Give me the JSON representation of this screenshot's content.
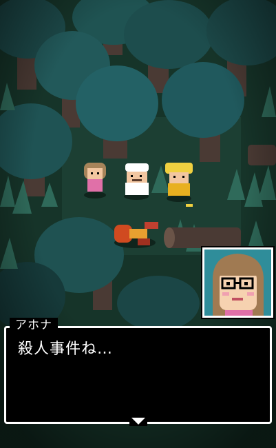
{
  "dialog": {
    "speaker": "アホナ",
    "text": "殺人事件ね…"
  },
  "scene": {
    "location_description": "",
    "characters": [
      "girl-npc",
      "chef-npc",
      "blond-npc",
      "fallen-victim"
    ]
  },
  "colors": {
    "forest_floor": "#143029",
    "tree_canopy": "#1e5a55",
    "tree_trunk": "#4a3a34",
    "dialog_bg": "#000000",
    "dialog_border": "#ffffff",
    "portrait_bg": "#2f8d9a"
  },
  "icons": {
    "advance": "triangle-down-icon"
  }
}
